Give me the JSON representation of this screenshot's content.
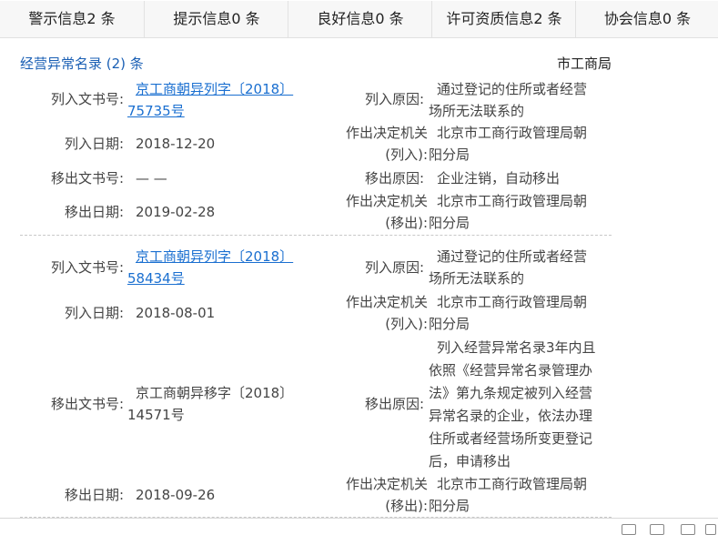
{
  "tabs": [
    {
      "label": "警示信息2 条"
    },
    {
      "label": "提示信息0 条"
    },
    {
      "label": "良好信息0 条"
    },
    {
      "label": "许可资质信息2 条"
    },
    {
      "label": "协会信息0 条"
    }
  ],
  "section": {
    "title": "经营异常名录 (2) 条",
    "authority": "市工商局"
  },
  "field_labels": {
    "list_doc": "列入文书号:",
    "list_date": "列入日期:",
    "remove_doc": "移出文书号:",
    "remove_date": "移出日期:",
    "list_reason": "列入原因:",
    "remove_reason": "移出原因:",
    "authority_a": "作出决定机关",
    "authority_list_b": "(列入):",
    "authority_remove_b": "(移出):"
  },
  "records": [
    {
      "list_doc_line1": "京工商朝异列字〔2018〕",
      "list_doc_line2": "75735号",
      "list_date": "2018-12-20",
      "remove_doc": "— —",
      "remove_date": "2019-02-28",
      "list_reason_line1": "通过登记的住所或者经营",
      "list_reason_line2": "场所无法联系的",
      "list_authority_line1": "北京市工商行政管理局朝",
      "list_authority_line2": "阳分局",
      "remove_reason": "企业注销，自动移出",
      "remove_authority_line1": "北京市工商行政管理局朝",
      "remove_authority_line2": "阳分局"
    },
    {
      "list_doc_line1": "京工商朝异列字〔2018〕",
      "list_doc_line2": "58434号",
      "list_date": "2018-08-01",
      "remove_doc_line1": "京工商朝异移字〔2018〕",
      "remove_doc_line2": "14571号",
      "remove_date": "2018-09-26",
      "list_reason_line1": "通过登记的住所或者经营",
      "list_reason_line2": "场所无法联系的",
      "list_authority_line1": "北京市工商行政管理局朝",
      "list_authority_line2": "阳分局",
      "remove_reason_lines": [
        "列入经营异常名录3年内且",
        "依照《经营异常名录管理办",
        "法》第九条规定被列入经营",
        "异常名录的企业，依法办理",
        "住所或者经营场所变更登记",
        "后，申请移出"
      ],
      "remove_authority_line1": "北京市工商行政管理局朝",
      "remove_authority_line2": "阳分局"
    }
  ]
}
